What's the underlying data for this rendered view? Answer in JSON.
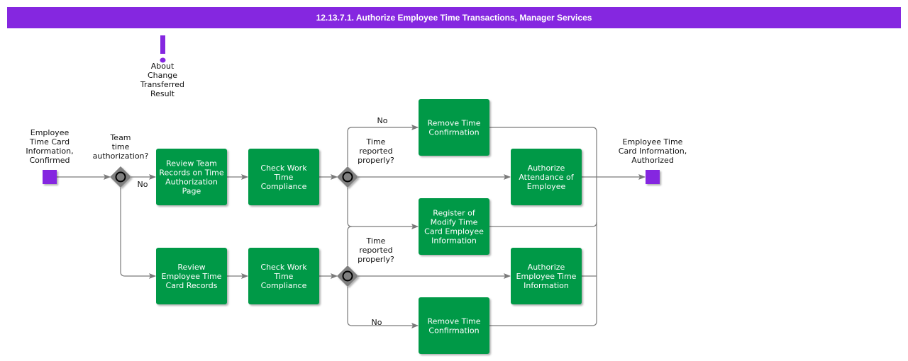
{
  "title": "12.13.7.1. Authorize Employee Time Transactions, Manager Services",
  "colors": {
    "title_bg": "#8527e0",
    "task": "#009947",
    "event": "#8527e0",
    "gateway": "#7f7f7f",
    "edge": "#7a7a7a"
  },
  "annotation": {
    "icon": "exclamation-icon",
    "lines": [
      "About",
      "Change",
      "Transferred",
      "Result"
    ]
  },
  "events": {
    "start": {
      "lines": [
        "Employee",
        "Time Card",
        "Information,",
        "Confirmed"
      ]
    },
    "end": {
      "lines": [
        "Employee Time",
        "Card Information,",
        "Authorized"
      ]
    }
  },
  "gateways": {
    "g1": {
      "lines": [
        "Team",
        "time",
        "authorization?"
      ]
    },
    "g2": {
      "lines": [
        "Time",
        "reported",
        "properly?"
      ]
    },
    "g3": {
      "lines": [
        "Time",
        "reported",
        "properly?"
      ]
    }
  },
  "tasks": {
    "review_team": {
      "lines": [
        "Review Team",
        "Records on Time",
        "Authorization",
        "Page"
      ]
    },
    "check1": {
      "lines": [
        "Check Work",
        "Time",
        "Compliance"
      ]
    },
    "remove1": {
      "lines": [
        "Remove Time",
        "Confirmation"
      ]
    },
    "authorize_att": {
      "lines": [
        "Authorize",
        "Attendance of",
        "Employee"
      ]
    },
    "register": {
      "lines": [
        "Register of",
        "Modify Time",
        "Card Employee",
        "Information"
      ]
    },
    "review_emp": {
      "lines": [
        "Review",
        "Employee Time",
        "Card Records"
      ]
    },
    "check2": {
      "lines": [
        "Check Work",
        "Time",
        "Compliance"
      ]
    },
    "authorize_emp": {
      "lines": [
        "Authorize",
        "Employee Time",
        "Information"
      ]
    },
    "remove2": {
      "lines": [
        "Remove Time",
        "Confirmation"
      ]
    }
  },
  "edge_labels": {
    "g1_no": "No",
    "g2_no": "No",
    "g3_no": "No"
  }
}
